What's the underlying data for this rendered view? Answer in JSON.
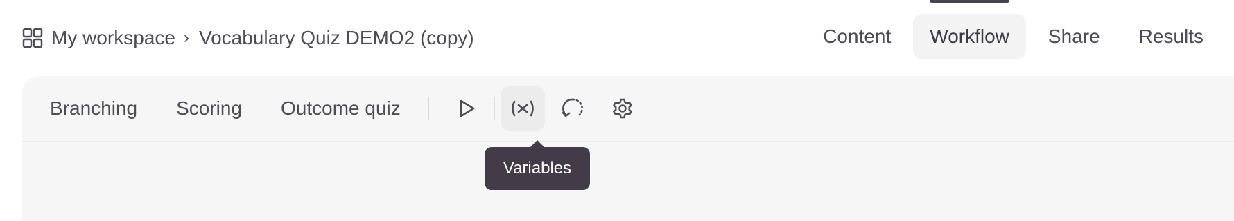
{
  "breadcrumb": {
    "workspace": "My workspace",
    "separator": "›",
    "project": "Vocabulary Quiz DEMO2 (copy)"
  },
  "tabs": [
    {
      "label": "Content",
      "active": false
    },
    {
      "label": "Workflow",
      "active": true
    },
    {
      "label": "Share",
      "active": false
    },
    {
      "label": "Results",
      "active": false
    }
  ],
  "toolbar": {
    "items": [
      "Branching",
      "Scoring",
      "Outcome quiz"
    ],
    "icons": [
      "play-icon",
      "variables-icon",
      "history-icon",
      "gear-icon"
    ]
  },
  "tooltip": {
    "text": "Variables"
  },
  "colors": {
    "tooltip_bg": "#433b47",
    "panel_bg": "#f6f6f6",
    "active_tab_bg": "#f3f3f4"
  }
}
